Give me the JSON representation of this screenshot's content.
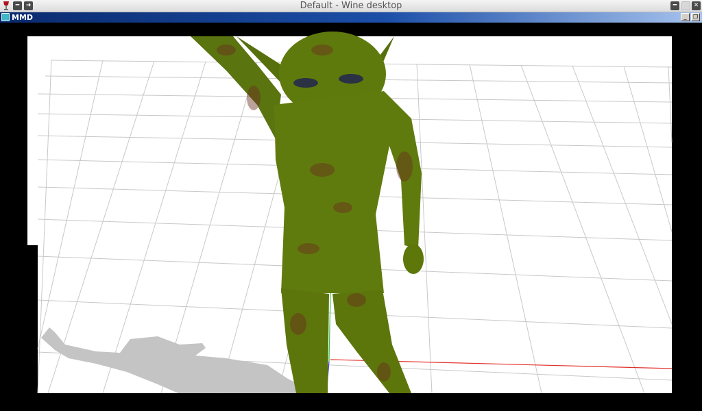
{
  "desktop": {
    "title": "Default - Wine desktop"
  },
  "mmd_window": {
    "title": "MMD"
  },
  "icons": {
    "wine": "wine-glass-icon",
    "minimize": "minimize-icon",
    "restore": "restore-icon",
    "close": "close-icon",
    "mmd": "mmd-app-icon"
  },
  "scene": {
    "background": "#ffffff",
    "grid_color": "#c8c8c8",
    "model_color": "#5f7a0c",
    "shadow_color": "#c4c4c4",
    "x_axis_color": "#e0302a",
    "y_axis_color": "#35c64a",
    "z_axis_color": "#3a3ad8"
  }
}
